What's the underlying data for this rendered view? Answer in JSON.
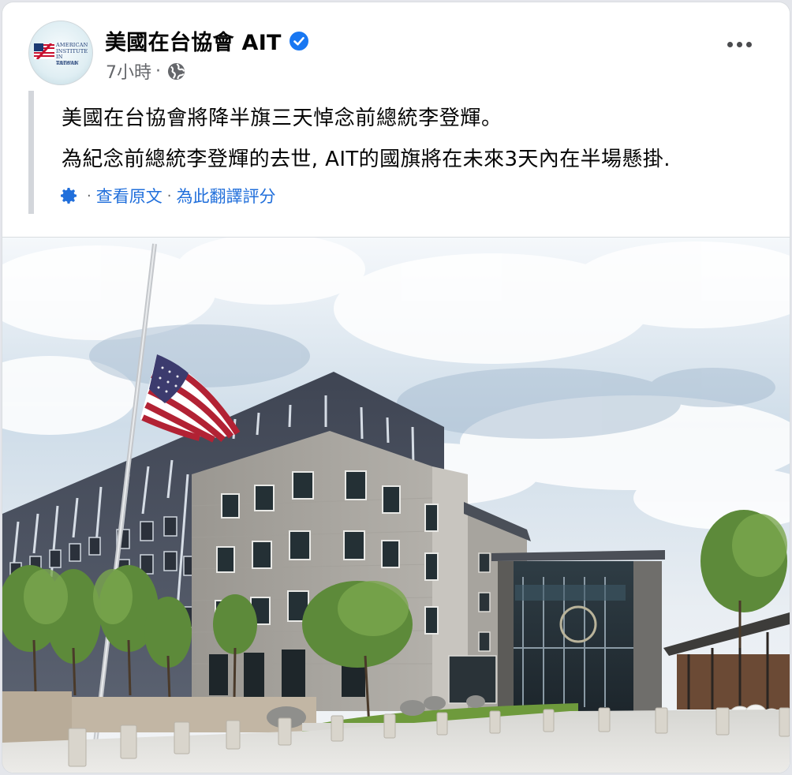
{
  "post": {
    "page_name": "美國在台協會 AIT",
    "verified": true,
    "timestamp": "7小時",
    "audience_icon": "globe-icon",
    "text_line1": "美國在台協會將降半旗三天悼念前總統李登輝。",
    "text_line2": "為紀念前總統李登輝的去世, AIT的國旗將在未來3天內在半場懸掛.",
    "see_original": "查看原文",
    "rate_translation": "為此翻譯評分"
  },
  "avatar": {
    "title_line1": "AMERICAN",
    "title_line2": "INSTITUTE IN",
    "title_line3": "TAIWAN",
    "subtitle": "美國在台協會"
  },
  "colors": {
    "link_blue": "#216fdb",
    "verified_blue": "#1877f2",
    "meta_gray": "#65676b"
  },
  "photo": {
    "subject": "AIT building with flag at half-mast"
  }
}
